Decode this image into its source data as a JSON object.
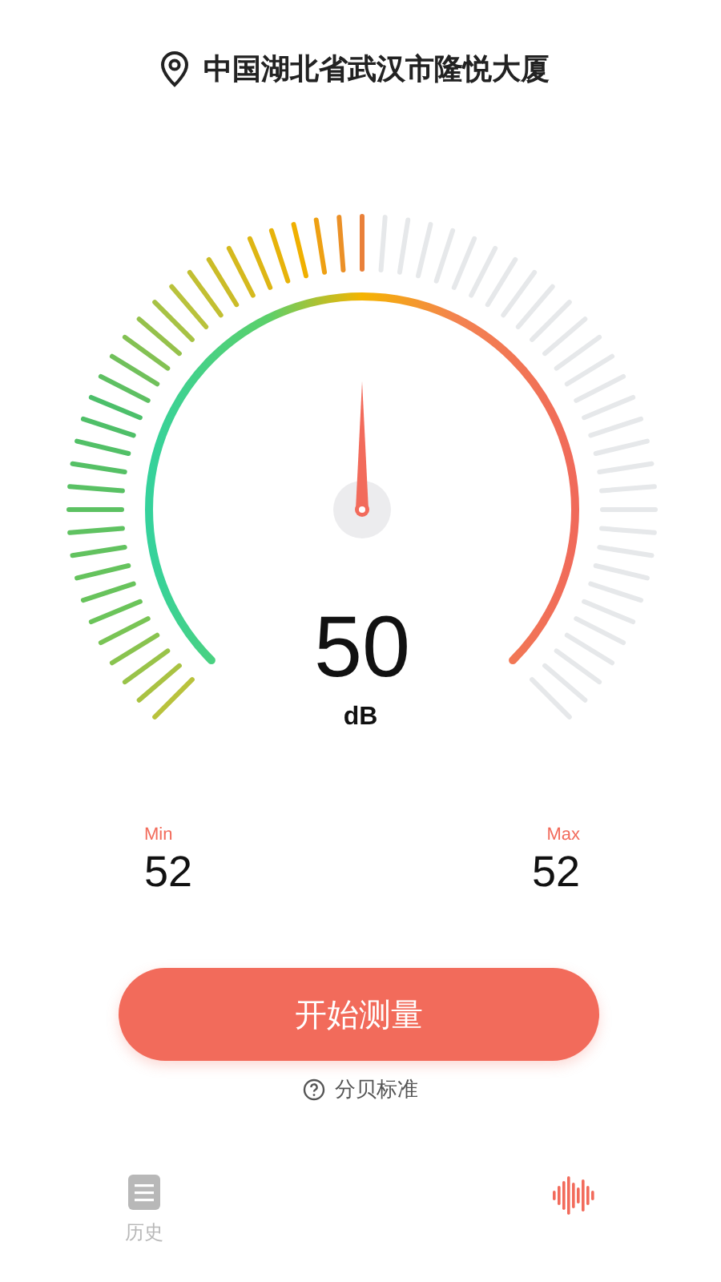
{
  "location": {
    "text": "中国湖北省武汉市隆悦大厦"
  },
  "gauge": {
    "reading": "50",
    "unit": "dB"
  },
  "stats": [
    {
      "label": "Min",
      "value": "52"
    },
    {
      "label": "Max",
      "value": "52"
    }
  ],
  "start_button": {
    "label": "开始测量"
  },
  "help_link": {
    "label": "分贝标准"
  },
  "tabs": [
    {
      "kind": "history",
      "label": "历史",
      "selected": false
    },
    {
      "kind": "meter",
      "selected": true
    }
  ]
}
